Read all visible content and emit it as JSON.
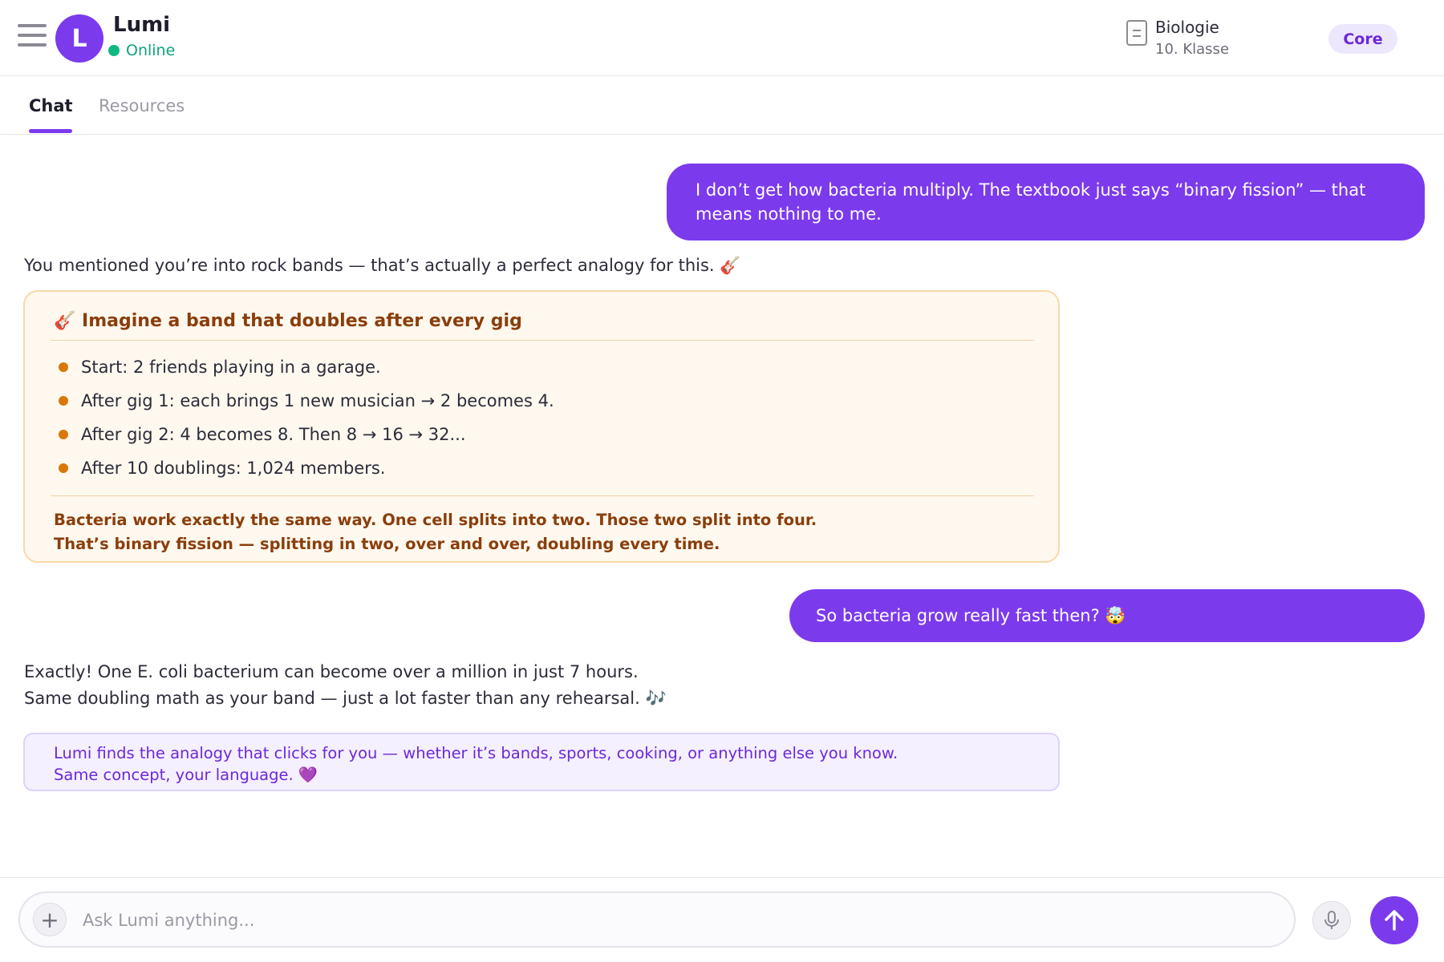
{
  "header": {
    "avatar_letter": "L",
    "bot_name": "Lumi",
    "status": "Online",
    "subject": "Biologie",
    "grade": "10. Klasse",
    "plan_badge": "Core"
  },
  "tabs": [
    {
      "label": "Chat",
      "active": true
    },
    {
      "label": "Resources",
      "active": false
    }
  ],
  "messages": {
    "user_1": "I don’t get how bacteria multiply. The textbook just says “binary fission” — that means nothing to me.",
    "bot_1": "You mentioned you’re into rock bands — that’s actually a perfect analogy for this. 🎸",
    "analogy": {
      "title": "🎸 Imagine a band that doubles after every gig",
      "bullets": [
        "Start: 2 friends playing in a garage.",
        "After gig 1: each brings 1 new musician → 2 becomes 4.",
        "After gig 2: 4 becomes 8. Then 8 → 16 → 32...",
        "After 10 doublings: 1,024 members."
      ],
      "summary_1": "Bacteria work exactly the same way. One cell splits into two. Those two split into four.",
      "summary_2": "That’s binary fission — splitting in two, over and over, doubling every time."
    },
    "user_2": "So bacteria grow really fast then? 🤯",
    "bot_2_line_1": "Exactly! One E. coli bacterium can become over a million in just 7 hours.",
    "bot_2_line_2": "Same doubling math as your band — just a lot faster than any rehearsal. 🎶",
    "info_line_1": "Lumi finds the analogy that clicks for you — whether it’s bands, sports, cooking, or anything else you know.",
    "info_line_2": "Same concept, your language. 💜"
  },
  "composer": {
    "placeholder": "Ask Lumi anything...",
    "value": "",
    "add_symbol": "+"
  },
  "colors": {
    "accent": "#7c3aed",
    "online": "#10b981",
    "analogy_bg": "#fff8ee",
    "analogy_text": "#8a3e0c",
    "info_bg": "#f4f0ff"
  },
  "icons": {
    "menu": "hamburger-menu-icon",
    "subject": "document-icon",
    "mic": "microphone-icon",
    "send": "arrow-up-icon"
  }
}
